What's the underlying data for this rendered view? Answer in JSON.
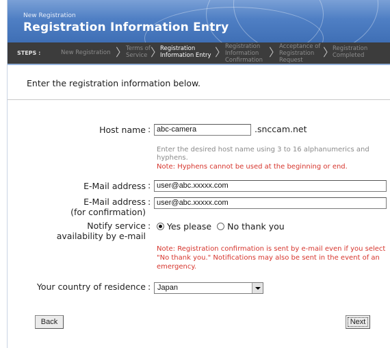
{
  "header": {
    "small_title": "New Registration",
    "title": "Registration Information Entry"
  },
  "steps": {
    "label": "STEPS :",
    "items": [
      {
        "label": "New Registration",
        "active": false
      },
      {
        "label": "Terms of\nService",
        "active": false
      },
      {
        "label": "Registration\nInformation Entry",
        "active": true
      },
      {
        "label": "Registration\nInformation\nConfirmation",
        "active": false
      },
      {
        "label": "Acceptance of\nRegistration\nRequest",
        "active": false
      },
      {
        "label": "Registration\nCompleted",
        "active": false
      }
    ]
  },
  "intro": "Enter the registration information below.",
  "form": {
    "host_name_label": "Host name",
    "host_name_value": "abc-camera",
    "host_suffix": ".snccam.net",
    "host_hint": "Enter the desired host name using 3 to 16 alphanumerics and hyphens.",
    "host_note": "Note: Hyphens cannot be used at the beginning or end.",
    "email_label": "E-Mail address",
    "email_value": "user@abc.xxxxx.com",
    "email_confirm_label_1": "E-Mail address",
    "email_confirm_label_2": "(for confirmation)",
    "email_confirm_value": "user@abc.xxxxx.com",
    "notify_label_1": "Notify service",
    "notify_label_2": "availability by e-mail",
    "notify_yes": "Yes please",
    "notify_no": "No thank you",
    "notify_note": "Note: Registration confirmation is sent by e-mail even if you select \"No thank you.\" Notifications may also be sent in the event of an emergency.",
    "country_label": "Your country of residence",
    "country_value": "Japan",
    "colon": ":"
  },
  "buttons": {
    "back": "Back",
    "next": "Next"
  },
  "colors": {
    "header_blue": "#4f7fc4",
    "steps_bar": "#3c3c3c",
    "note_red": "#d6342c"
  }
}
